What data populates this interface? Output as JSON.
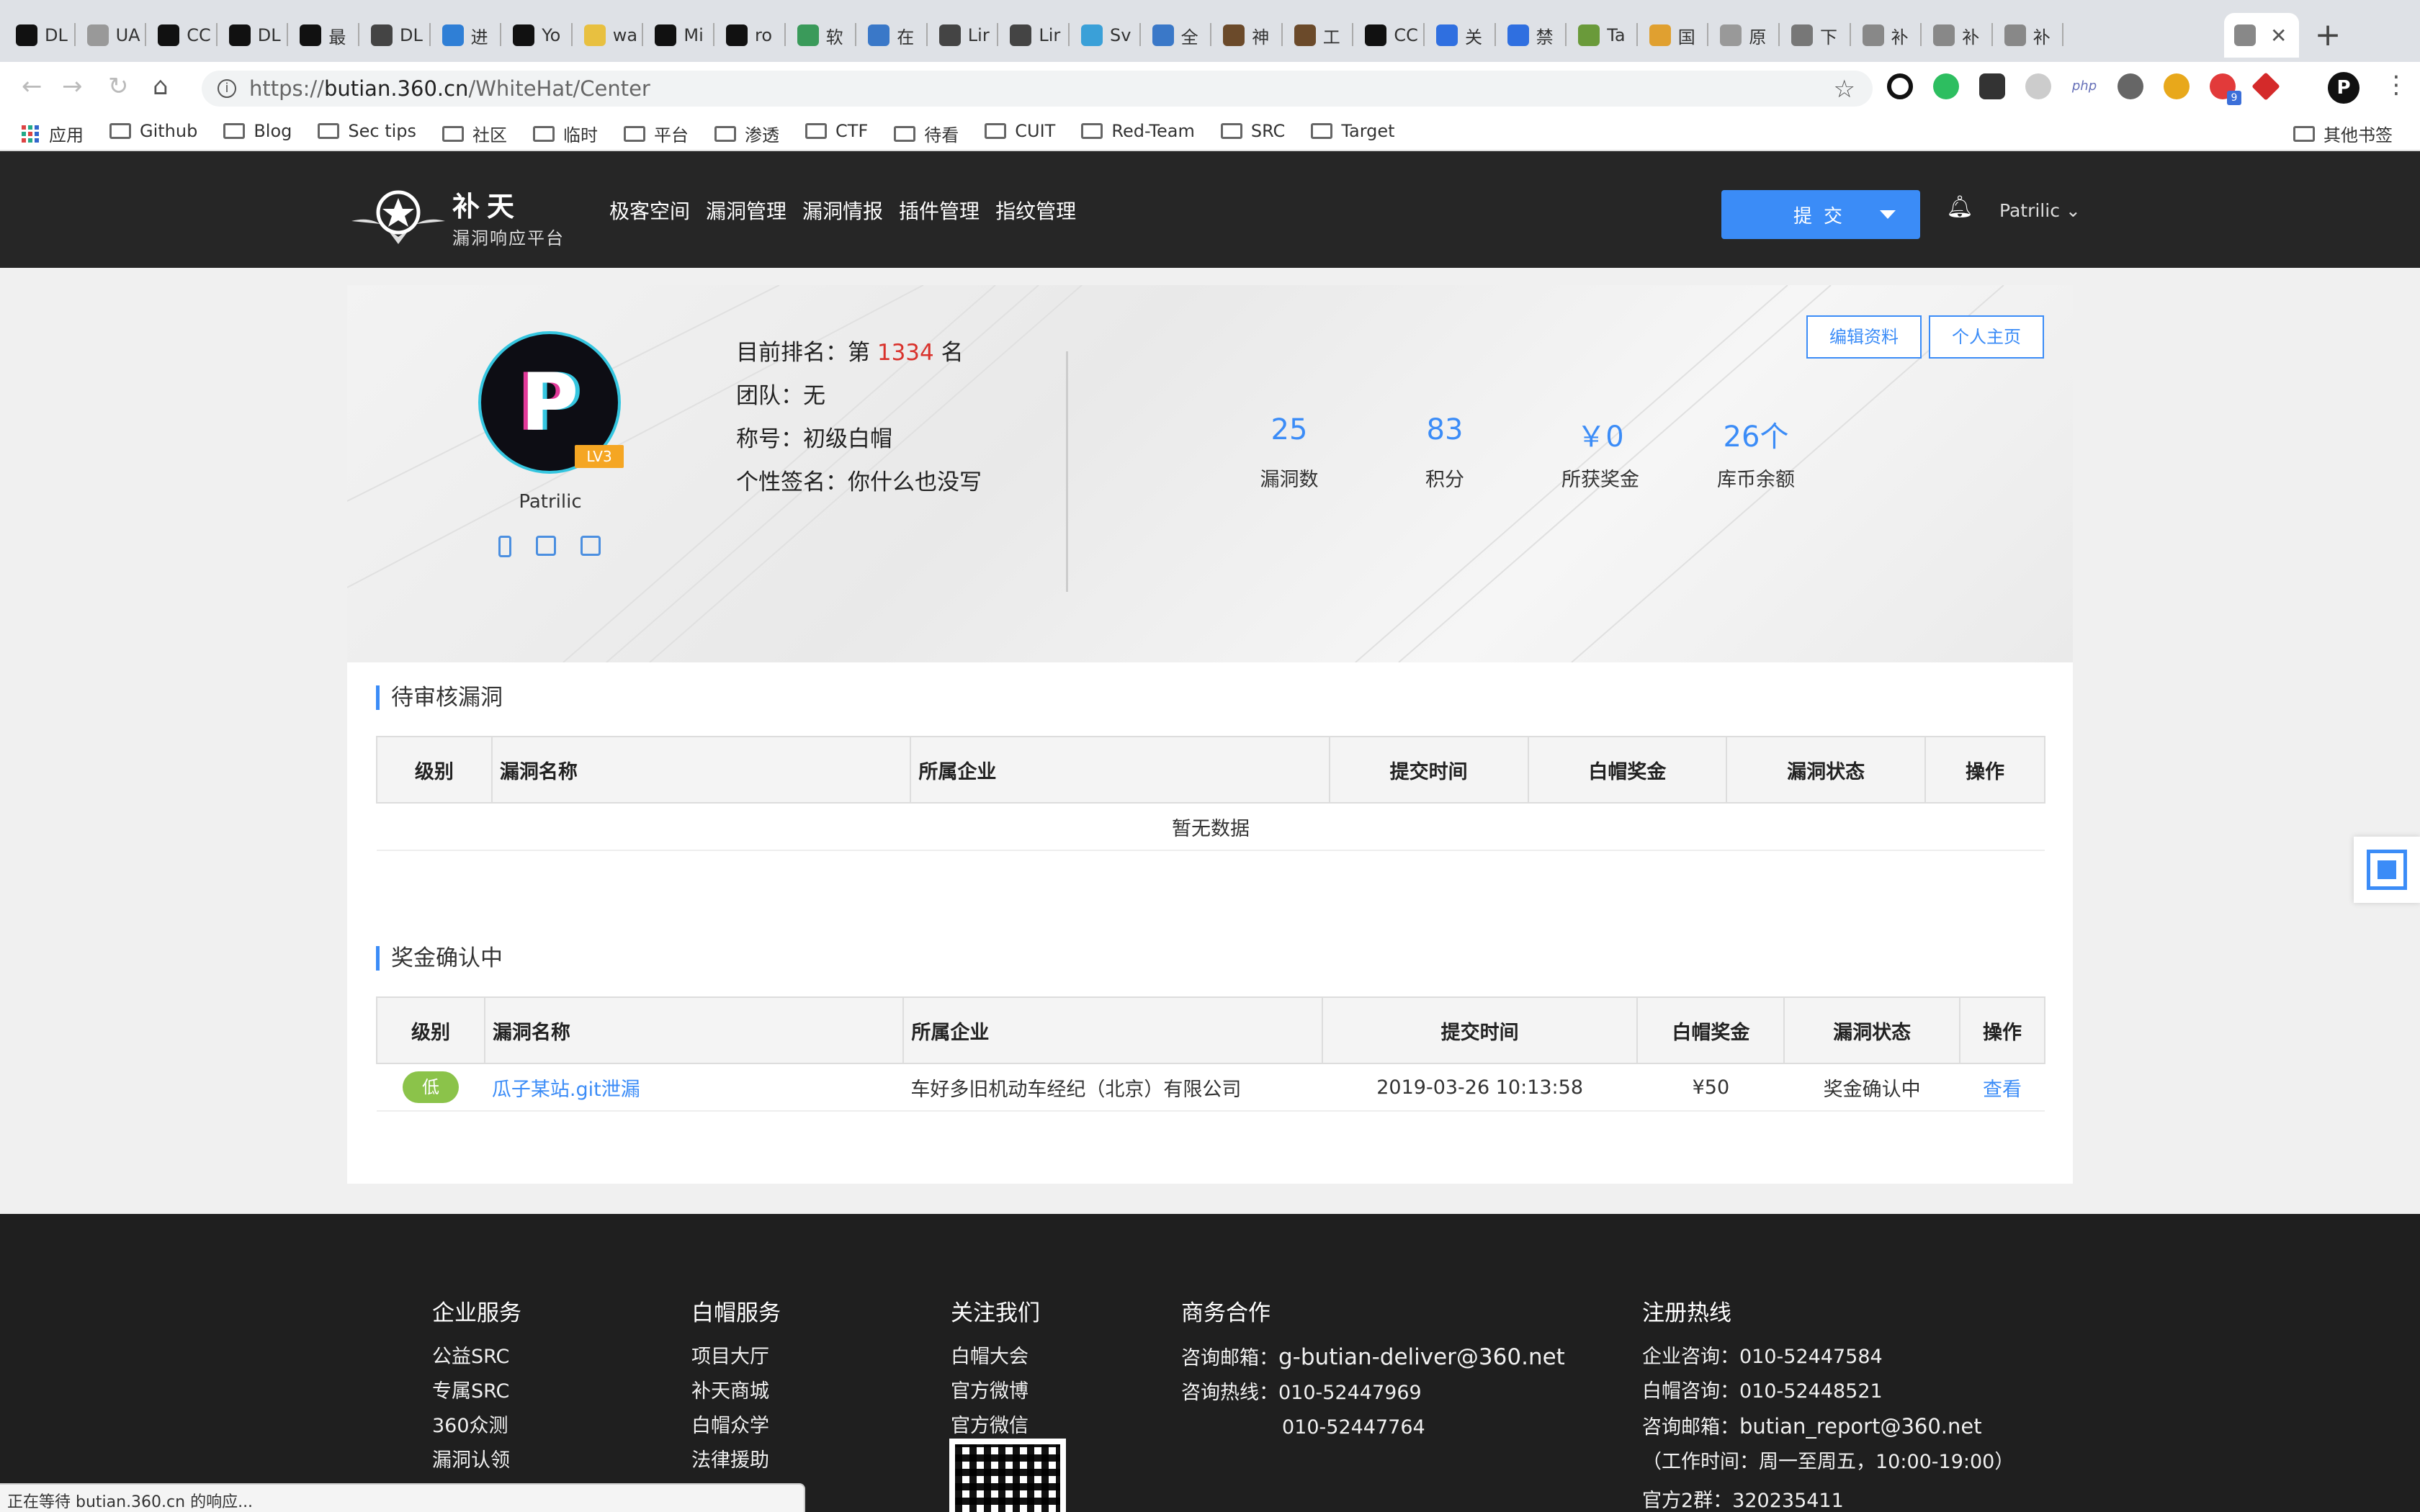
{
  "browser": {
    "tabs": [
      {
        "label": "DL",
        "icon": "github-icon"
      },
      {
        "label": "UA",
        "icon": "document-icon"
      },
      {
        "label": "CC",
        "icon": "github-icon"
      },
      {
        "label": "DL",
        "icon": "github-icon"
      },
      {
        "label": "最",
        "icon": "github-icon"
      },
      {
        "label": "DL",
        "icon": "linux-icon"
      },
      {
        "label": "进",
        "icon": "windows-icon"
      },
      {
        "label": "Yo",
        "icon": "github-icon"
      },
      {
        "label": "wa",
        "icon": "zhihu-icon"
      },
      {
        "label": "Mi",
        "icon": "github-icon"
      },
      {
        "label": "ro",
        "icon": "github-icon"
      },
      {
        "label": "软",
        "icon": "book-icon"
      },
      {
        "label": "在",
        "icon": "code-icon"
      },
      {
        "label": "Lir",
        "icon": "linux-icon"
      },
      {
        "label": "Lir",
        "icon": "linux-icon"
      },
      {
        "label": "Sv",
        "icon": "circle-icon"
      },
      {
        "label": "全",
        "icon": "globe-icon"
      },
      {
        "label": "神",
        "icon": "avatar-icon"
      },
      {
        "label": "工",
        "icon": "avatar-icon"
      },
      {
        "label": "CC",
        "icon": "github-icon"
      },
      {
        "label": "关",
        "icon": "baidu-icon"
      },
      {
        "label": "禁",
        "icon": "baidu-icon"
      },
      {
        "label": "Ta",
        "icon": "plant-icon"
      },
      {
        "label": "国",
        "icon": "chrome-icon"
      },
      {
        "label": "原",
        "icon": "document-icon"
      },
      {
        "label": "下",
        "icon": "download-icon"
      },
      {
        "label": "补",
        "icon": "star-icon"
      },
      {
        "label": "补",
        "icon": "star-icon"
      },
      {
        "label": "补",
        "icon": "star-icon"
      }
    ],
    "active_tab_close": "✕",
    "new_tab": "+",
    "url_scheme": "https://",
    "url_host": "butian.360.cn",
    "url_path": "/WhiteHat/Center",
    "bookmarks": [
      {
        "label": "应用",
        "kind": "apps"
      },
      {
        "label": "Github",
        "kind": "folder"
      },
      {
        "label": "Blog",
        "kind": "folder"
      },
      {
        "label": "Sec tips",
        "kind": "folder"
      },
      {
        "label": "社区",
        "kind": "folder"
      },
      {
        "label": "临时",
        "kind": "folder"
      },
      {
        "label": "平台",
        "kind": "folder"
      },
      {
        "label": "渗透",
        "kind": "folder"
      },
      {
        "label": "CTF",
        "kind": "folder"
      },
      {
        "label": "待看",
        "kind": "folder"
      },
      {
        "label": "CUIT",
        "kind": "folder"
      },
      {
        "label": "Red-Team",
        "kind": "folder"
      },
      {
        "label": "SRC",
        "kind": "folder"
      },
      {
        "label": "Target",
        "kind": "folder"
      }
    ],
    "other_bookmarks": "其他书签",
    "ext_badge": "9",
    "profile_initial": "P",
    "status_text": "正在等待 butian.360.cn 的响应..."
  },
  "header": {
    "logo_main": "补天",
    "logo_sub": "漏洞响应平台",
    "nav": [
      "极客空间",
      "漏洞管理",
      "漏洞情报",
      "插件管理",
      "指纹管理"
    ],
    "submit_label": "提交",
    "user_name": "Patrilic",
    "user_caret": "⌄"
  },
  "profile": {
    "avatar_letter": "P",
    "level": "LV3",
    "username": "Patrilic",
    "rank_prefix": "目前排名：第",
    "rank": "1334",
    "rank_suffix": "名",
    "team": "团队：无",
    "title": "称号：初级白帽",
    "signature": "个性签名：你什么也没写",
    "edit_button": "编辑资料",
    "homepage_button": "个人主页",
    "stats": [
      {
        "value": "25",
        "label": "漏洞数"
      },
      {
        "value": "83",
        "label": "积分"
      },
      {
        "value": "￥0",
        "label": "所获奖金"
      },
      {
        "value": "26个",
        "label": "库币余额"
      }
    ]
  },
  "pending": {
    "title": "待审核漏洞",
    "columns": [
      "级别",
      "漏洞名称",
      "所属企业",
      "提交时间",
      "白帽奖金",
      "漏洞状态",
      "操作"
    ],
    "empty_text": "暂无数据"
  },
  "bounty": {
    "title": "奖金确认中",
    "columns": [
      "级别",
      "漏洞名称",
      "所属企业",
      "提交时间",
      "白帽奖金",
      "漏洞状态",
      "操作"
    ],
    "rows": [
      {
        "level": "低",
        "name": "瓜子某站.git泄漏",
        "company": "车好多旧机动车经纪（北京）有限公司",
        "time": "2019-03-26 10:13:58",
        "bonus": "¥50",
        "status": "奖金确认中",
        "action": "查看"
      }
    ]
  },
  "footer": {
    "enterprise": {
      "heading": "企业服务",
      "items": [
        "公益SRC",
        "专属SRC",
        "360众测",
        "漏洞认领"
      ]
    },
    "whitehat": {
      "heading": "白帽服务",
      "items": [
        "项目大厅",
        "补天商城",
        "白帽众学",
        "法律援助"
      ]
    },
    "follow": {
      "heading": "关注我们",
      "items": [
        "白帽大会",
        "官方微博",
        "官方微信"
      ]
    },
    "business": {
      "heading": "商务合作",
      "email_label": "咨询邮箱：",
      "email": "g-butian-deliver@360.net",
      "phone_label": "咨询热线：",
      "phone1": "010-52447969",
      "phone2": "010-52447764"
    },
    "register": {
      "heading": "注册热线",
      "enterprise": "企业咨询：010-52447584",
      "whitehat": "白帽咨询：010-52448521",
      "email_label": "咨询邮箱：",
      "email": "butian_report@360.net",
      "hours": "（工作时间：周一至周五，10:00-19:00）",
      "group": "官方2群：320235411"
    }
  },
  "colors": {
    "accent": "#3b8cf7",
    "header_bg": "#262626",
    "footer_bg": "#1f1f1f",
    "rank": "#d9322c",
    "low_level": "#8bc34a",
    "bonus": "#e2522c"
  }
}
